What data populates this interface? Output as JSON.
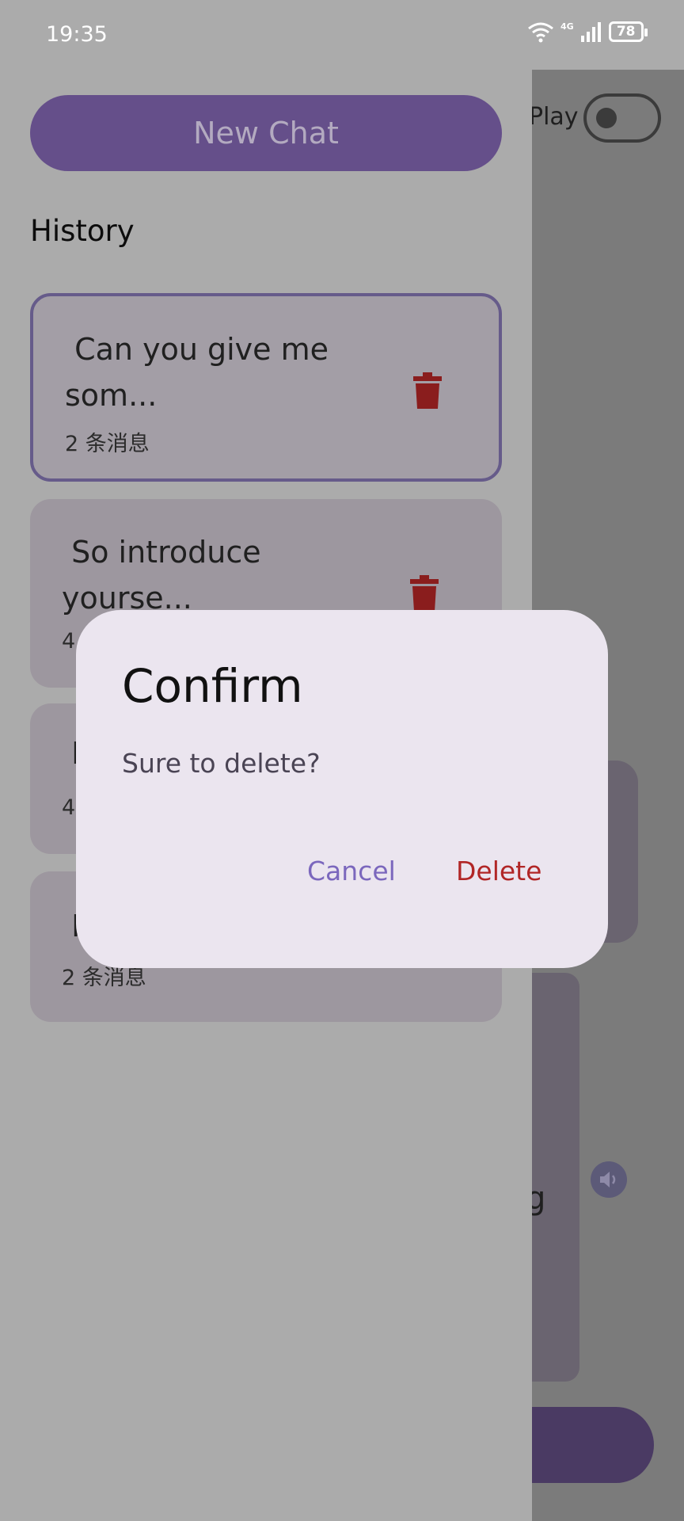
{
  "status_bar": {
    "time": "19:35",
    "battery": "78",
    "network": "4G"
  },
  "main": {
    "auto_play_label": "Play",
    "partial_text": "g"
  },
  "drawer": {
    "new_chat_label": "New Chat",
    "history_label": "History",
    "items": [
      {
        "title": " Can you give me\nsom...",
        "count": "2 条消息"
      },
      {
        "title": " So introduce\nyourse...",
        "count": "4"
      },
      {
        "title": " H",
        "count": "4"
      },
      {
        "title": " H",
        "count": "2 条消息"
      }
    ]
  },
  "dialog": {
    "title": "Confirm",
    "message": "Sure to delete?",
    "cancel_label": "Cancel",
    "delete_label": "Delete"
  },
  "colors": {
    "accent": "#7b67bd",
    "danger": "#b12626",
    "trash_icon": "#8a1d1d",
    "selected_border": "#665b8a"
  },
  "icons": [
    "trash-icon",
    "wifi-icon",
    "signal-icon",
    "battery-icon",
    "speaker-icon"
  ]
}
